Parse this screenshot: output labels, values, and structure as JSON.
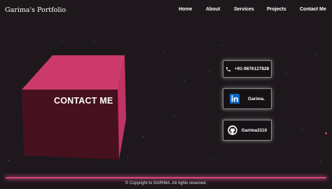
{
  "header": {
    "brand": "Garima's Portfolio",
    "nav": [
      "Home",
      "About",
      "Services",
      "Projects",
      "Contact Me"
    ]
  },
  "hero": {
    "cube_label": "CONTACT ME"
  },
  "contacts": {
    "phone": {
      "icon": "phone-icon",
      "text": "+91-9876127828"
    },
    "linkedin": {
      "icon": "linkedin-icon",
      "text": "Garima."
    },
    "github": {
      "icon": "github-icon",
      "text": "Garima3110"
    }
  },
  "footer": {
    "copyright": "© Copyright to GARIMA. All rights reserved."
  },
  "colors": {
    "background": "#1e181c",
    "cube_front": "#47101f",
    "cube_top": "#cc3a6c",
    "cube_side": "#c13364",
    "accent": "#d4487e",
    "linkedin": "#0a66c2"
  }
}
